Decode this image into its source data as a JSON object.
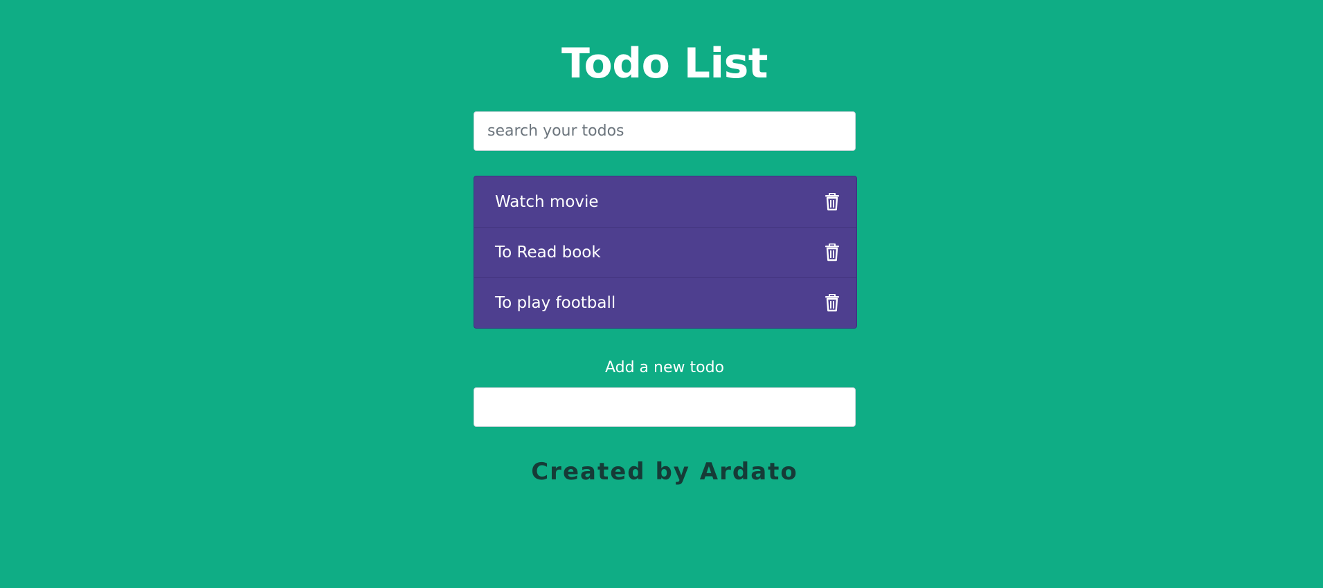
{
  "header": {
    "title": "Todo List"
  },
  "search": {
    "placeholder": "search your todos",
    "value": ""
  },
  "todos": [
    {
      "text": "Watch movie",
      "icon": "trash-icon"
    },
    {
      "text": "To Read book",
      "icon": "trash-icon"
    },
    {
      "text": "To play football",
      "icon": "trash-icon"
    }
  ],
  "add_todo": {
    "label": "Add a new todo",
    "value": ""
  },
  "footer": {
    "text": "Created by Ardato"
  },
  "colors": {
    "background": "#0fad85",
    "list_background": "#4e3f8f",
    "text": "#ffffff",
    "footer_text": "#163b37"
  }
}
